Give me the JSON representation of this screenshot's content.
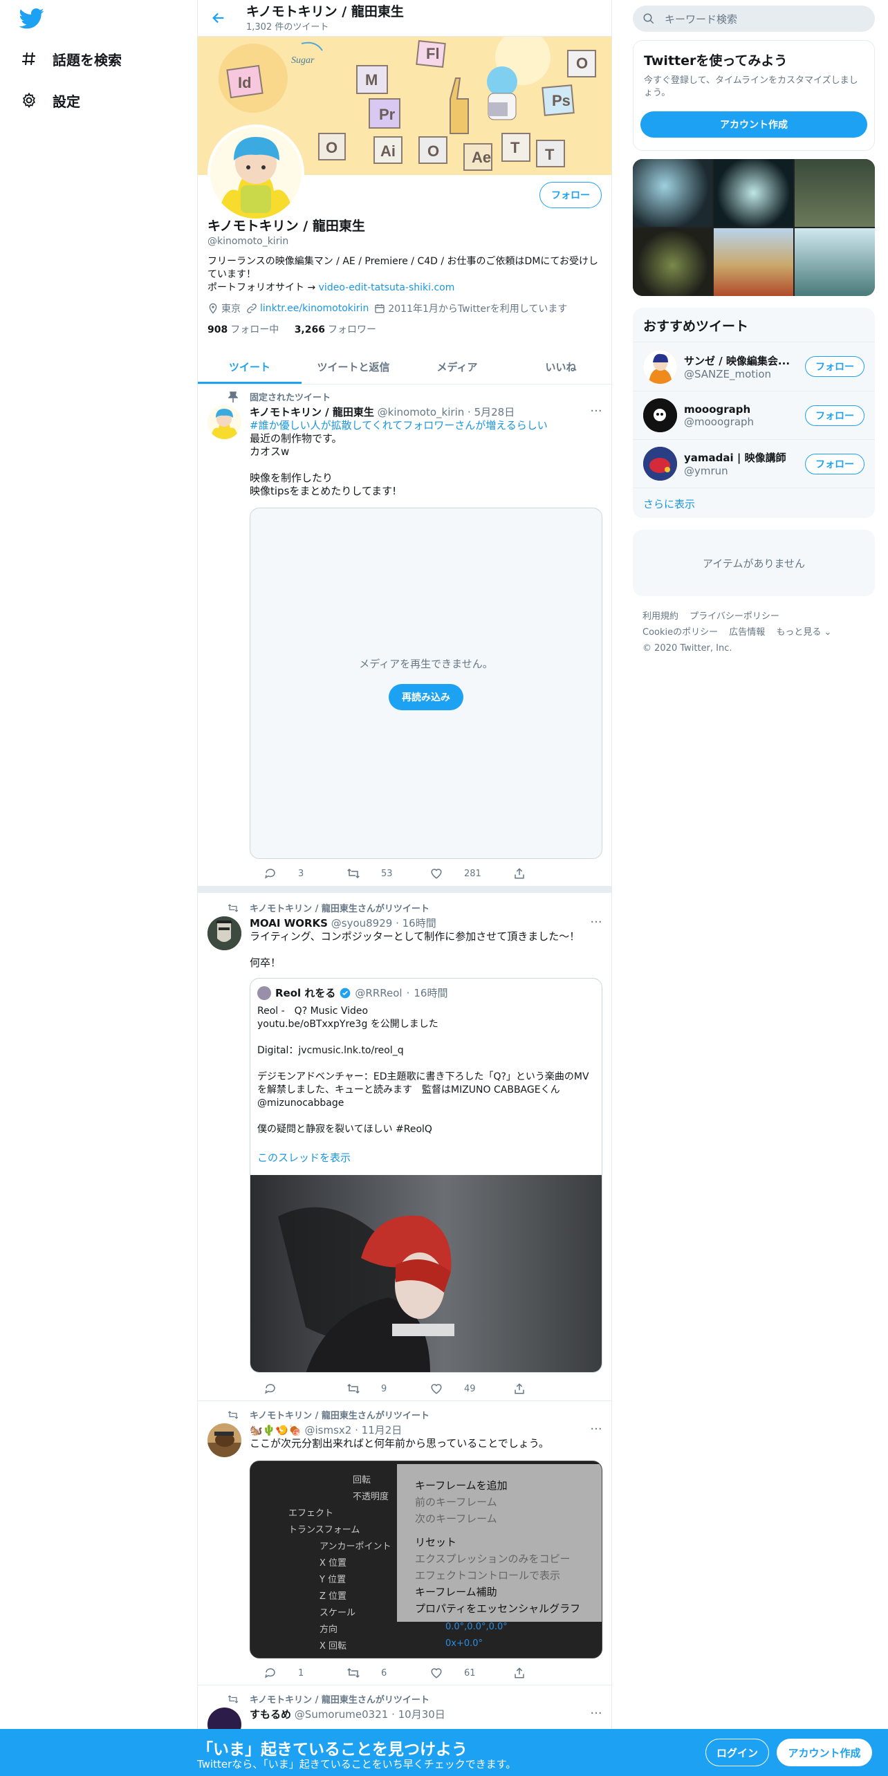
{
  "nav": {
    "explore_label": "話題を検索",
    "settings_label": "設定"
  },
  "header": {
    "title": "キノモトキリン / 龍田東生",
    "tweet_count": "1,302 件のツイート"
  },
  "profile": {
    "follow_label": "フォロー",
    "name": "キノモトキリン / 龍田東生",
    "handle": "@kinomoto_kirin",
    "bio": "フリーランスの映像編集マン / AE / Premiere / C4D / お仕事のご依頼はDMにてお受けしています！",
    "portfolio_prefix": "ポートフォリオサイト → ",
    "portfolio_link": "video-edit-tatsuta-shiki.com",
    "location": "東京",
    "website": "linktr.ee/kinomotokirin",
    "joined": "2011年1月からTwitterを利用しています",
    "following_count": "908",
    "following_label": "フォロー中",
    "followers_count": "3,266",
    "followers_label": "フォロワー"
  },
  "tabs": [
    "ツイート",
    "ツイートと返信",
    "メディア",
    "いいね"
  ],
  "tweets": [
    {
      "social": "固定されたツイート",
      "name": "キノモトキリン / 龍田東生",
      "handle": "@kinomoto_kirin",
      "time": "5月28日",
      "hashtag": "#誰か優しい人が拡散してくれてフォロワーさんが増えるらしい",
      "text": "最近の制作物です。\nカオスw\n\n映像を制作したり\n映像tipsをまとめたりしてます!",
      "media_error": "メディアを再生できません。",
      "reload_label": "再読み込み",
      "replies": "3",
      "retweets": "53",
      "likes": "281"
    },
    {
      "social": "キノモトキリン / 龍田東生さんがリツイート",
      "name": "MOAI WORKS",
      "handle": "@syou8929",
      "time": "16時間",
      "text": "ライティング、コンポジッターとして制作に参加させて頂きました〜！\n\n何卒！",
      "quote": {
        "name": "Reol れをる",
        "handle": "@RRReol",
        "time": "16時間",
        "text": "Reol -　Q? Music Video\nyoutu.be/oBTxxpYre3g を公開しました\n\nDigital：jvcmusic.lnk.to/reol_q\n\nデジモンアドベンチャー：ED主題歌に書き下ろした「Q?」という楽曲のMVを解禁しました、キューと読みます　監督はMIZUNO CABBAGEくん\n@mizunocabbage\n\n僕の疑問と静寂を裂いてほしい #ReolQ",
        "thread_link": "このスレッドを表示"
      },
      "replies": "",
      "retweets": "9",
      "likes": "49"
    },
    {
      "social": "キノモトキリン / 龍田東生さんがリツイート",
      "name": "🐿️🌵🍤🍖",
      "handle": "@ismsx2",
      "time": "11月2日",
      "text": "ここが次元分割出来ればと何年前から思っていることでしょう。",
      "ae_layers": [
        "回転",
        "不透明度",
        "エフェクト",
        "トランスフォーム",
        "アンカーポイント",
        "X 位置",
        "Y 位置",
        "Z 位置",
        "スケール",
        "方向",
        "X 回転"
      ],
      "ae_values": [
        "0.0°,0.0°,0.0°",
        "0x+0.0°"
      ],
      "ae_menu": [
        "キーフレームを追加",
        "前のキーフレーム",
        "次のキーフレーム",
        "リセット",
        "エクスプレッションのみをコピー",
        "エフェクトコントロールで表示",
        "キーフレーム補助",
        "プロパティをエッセンシャルグラフ"
      ],
      "replies": "1",
      "retweets": "6",
      "likes": "61"
    },
    {
      "social": "キノモトキリン / 龍田東生さんがリツイート",
      "name": "すもるめ",
      "handle": "@Sumorume0321",
      "time": "10月30日"
    }
  ],
  "right": {
    "search_placeholder": "キーワード検索",
    "signup_title": "Twitterを使ってみよう",
    "signup_text": "今すぐ登録して、タイムラインをカスタマイズしましょう。",
    "signup_button": "アカウント作成",
    "suggest_title": "おすすめツイート",
    "suggestions": [
      {
        "name": "サンゼ / 映像編集会...",
        "handle": "@SANZE_motion",
        "follow": "フォロー"
      },
      {
        "name": "mooograph",
        "handle": "@mooograph",
        "follow": "フォロー"
      },
      {
        "name": "yamadai | 映像講師",
        "handle": "@ymrun",
        "follow": "フォロー"
      }
    ],
    "show_more": "さらに表示",
    "no_items": "アイテムがありません",
    "footer": [
      "利用規約",
      "プライバシーポリシー",
      "Cookieのポリシー",
      "広告情報",
      "もっと見る ⌄",
      "© 2020 Twitter, Inc."
    ]
  },
  "bottom_bar": {
    "headline": "「いま」起きていることを見つけよう",
    "sub": "Twitterなら、「いま」起きていることをいち早くチェックできます。",
    "login": "ログイン",
    "signup": "アカウント作成"
  },
  "colors": {
    "accent": "#1da1f2",
    "border": "#e6ecf0",
    "muted": "#657786"
  }
}
